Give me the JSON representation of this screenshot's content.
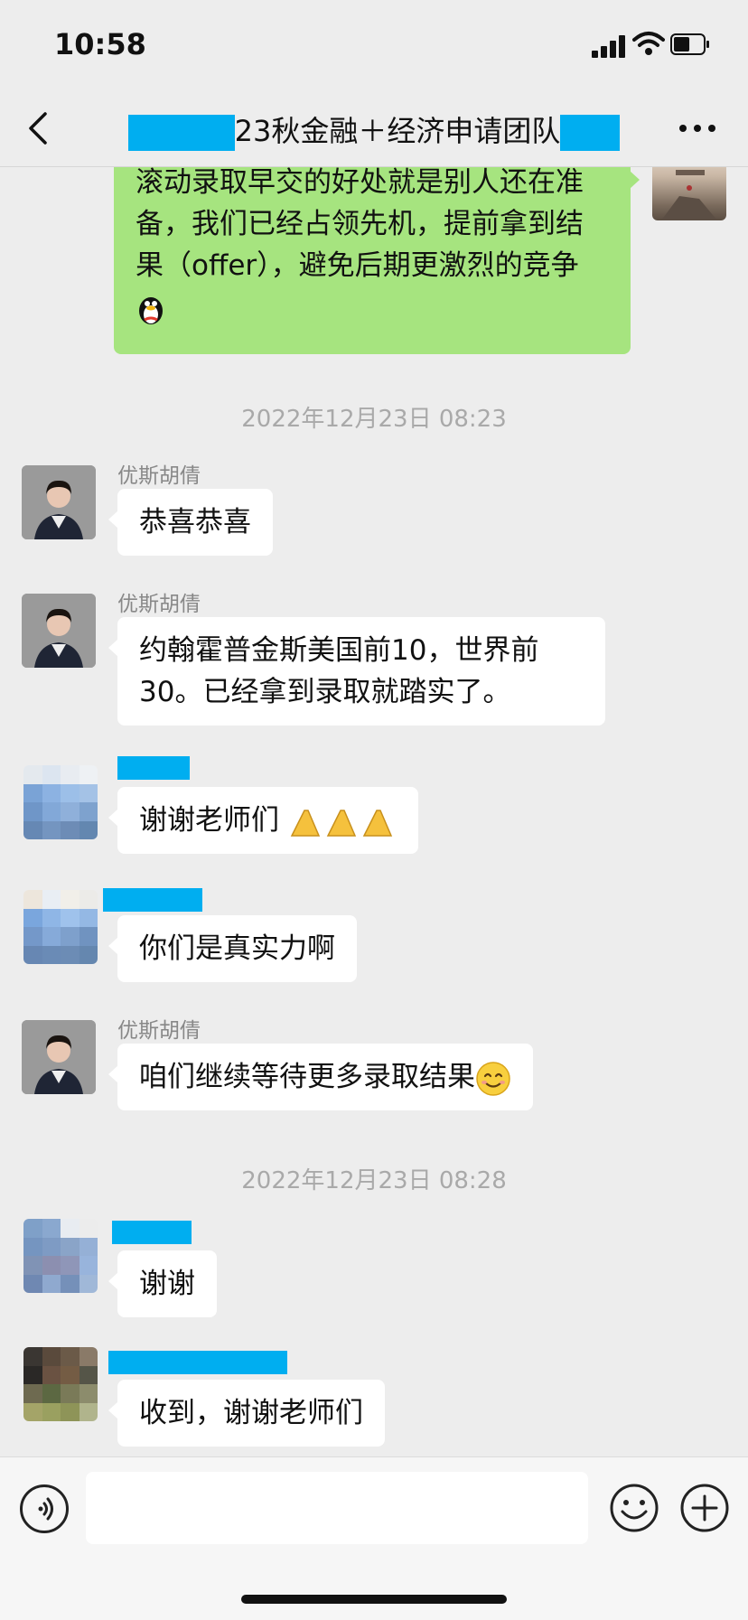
{
  "status_bar": {
    "time": "10:58",
    "battery_level": 0.55
  },
  "nav": {
    "title_text": "23秋金融＋经济申请团队"
  },
  "messages": {
    "m0": "滚动录取早交的好处就是别人还在准备，我们已经占领先机，提前拿到结果（offer），避免后期更激烈的竞争",
    "ts1": "2022年12月23日 08:23",
    "m1_sender": "优斯胡倩",
    "m1": "恭喜恭喜",
    "m2_sender": "优斯胡倩",
    "m2_line1": "约翰霍普金斯美国前10，世界前",
    "m2_line2": "30。已经拿到录取就踏实了。",
    "m3": "谢谢老师们",
    "m4": "你们是真实力啊",
    "m5_sender": "优斯胡倩",
    "m5": "咱们继续等待更多录取结果",
    "ts2": "2022年12月23日 08:28",
    "m6": "谢谢",
    "m7": "收到，谢谢老师们"
  },
  "icons": {
    "back": "chevron-left-icon",
    "more": "more-dots-icon",
    "voice": "voice-icon",
    "emoji": "smiley-icon",
    "plus": "plus-icon"
  },
  "colors": {
    "background": "#ededed",
    "green_bubble": "#a6e47f",
    "redaction": "#00aef0",
    "timestamp": "#a9a9a9"
  }
}
